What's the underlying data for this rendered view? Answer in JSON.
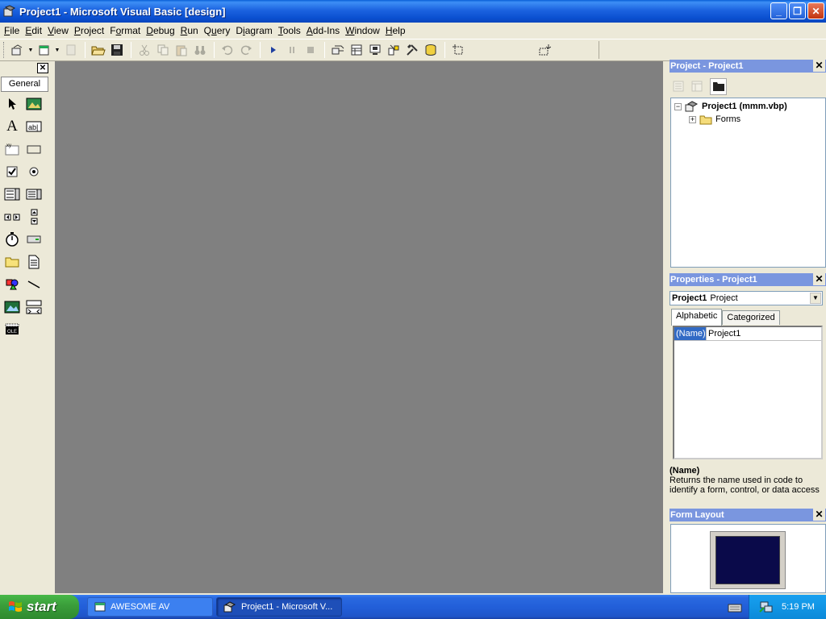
{
  "window": {
    "title": "Project1 - Microsoft Visual Basic [design]"
  },
  "menu": [
    "File",
    "Edit",
    "View",
    "Project",
    "Format",
    "Debug",
    "Run",
    "Query",
    "Diagram",
    "Tools",
    "Add-Ins",
    "Window",
    "Help"
  ],
  "menu_underline": [
    "F",
    "E",
    "V",
    "P",
    "o",
    "D",
    "R",
    "u",
    "i",
    "T",
    "A",
    "W",
    "H"
  ],
  "toolbox": {
    "tab_label": "General"
  },
  "project_pane": {
    "title": "Project - Project1",
    "root": "Project1 (mmm.vbp)",
    "child": "Forms"
  },
  "properties_pane": {
    "title": "Properties - Project1",
    "object_name": "Project1",
    "object_type": "Project",
    "tabs": [
      "Alphabetic",
      "Categorized"
    ],
    "rows": [
      {
        "name": "(Name)",
        "value": "Project1"
      }
    ],
    "desc_title": "(Name)",
    "desc_text": "Returns the name used in code to identify a form, control, or data access"
  },
  "form_layout": {
    "title": "Form Layout"
  },
  "taskbar": {
    "start_label": "start",
    "tasks": [
      "AWESOME AV",
      "Project1 - Microsoft V..."
    ],
    "clock": "5:19 PM"
  },
  "colors": {
    "mdi_background": "#808080",
    "pane_title": "#7a96df",
    "selection": "#316ac5"
  }
}
